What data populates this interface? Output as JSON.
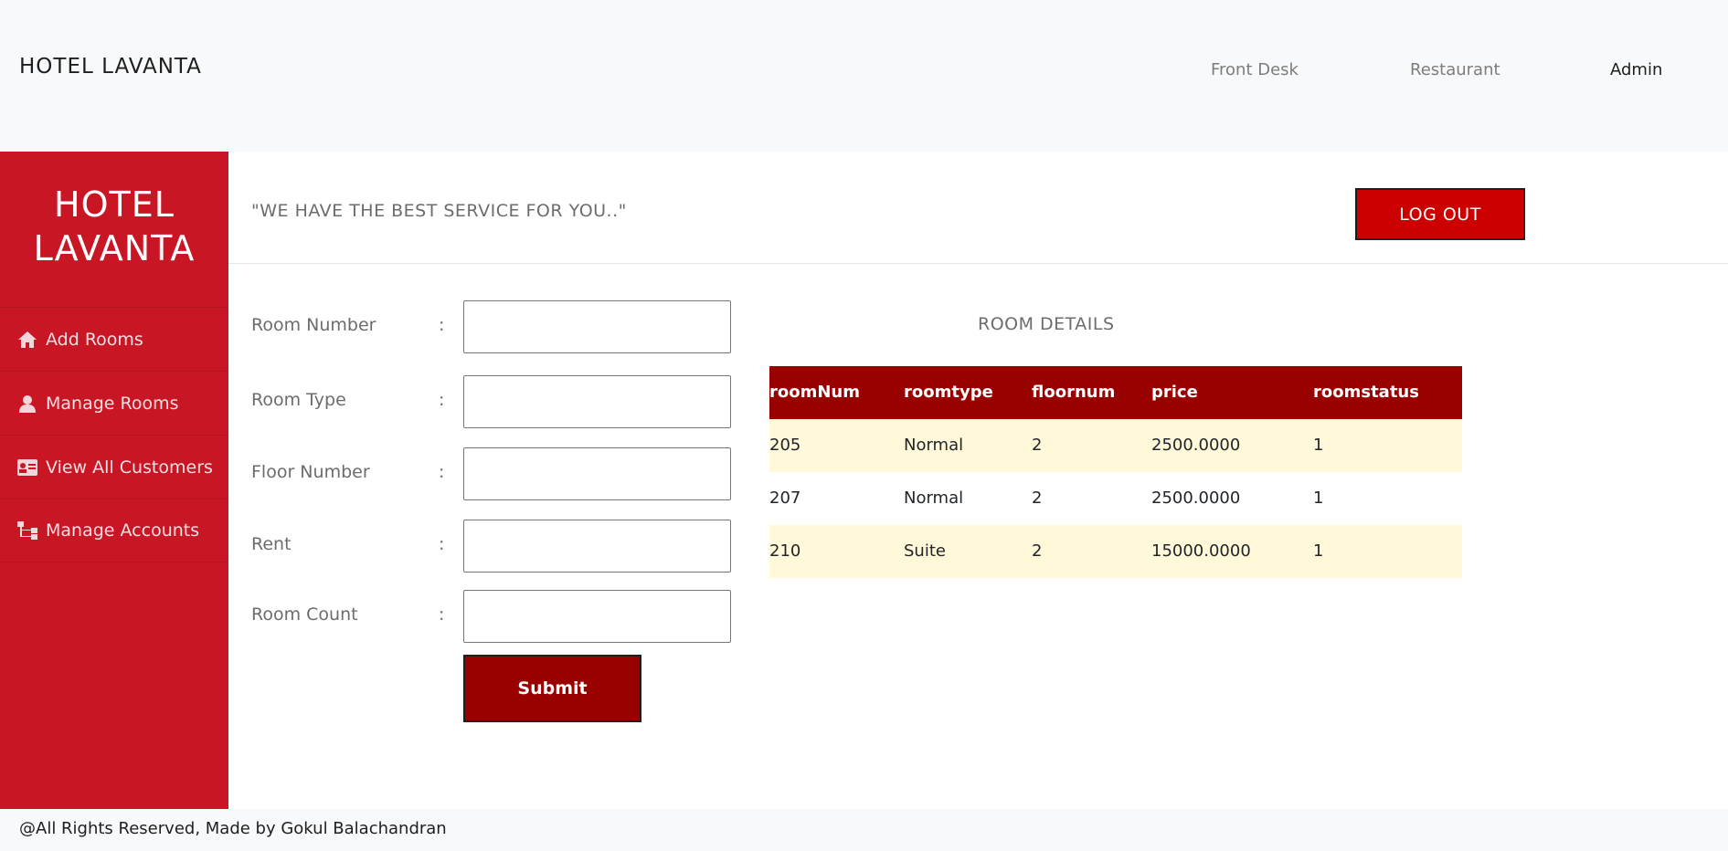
{
  "header": {
    "brand": "HOTEL LAVANTA",
    "nav": [
      {
        "label": "Front Desk"
      },
      {
        "label": "Restaurant"
      },
      {
        "label": "Admin"
      }
    ]
  },
  "sidebar": {
    "title_line1": "HOTEL",
    "title_line2": "LAVANTA",
    "items": [
      {
        "label": "Add Rooms",
        "icon": "home-icon"
      },
      {
        "label": "Manage Rooms",
        "icon": "user-icon"
      },
      {
        "label": "View All Customers",
        "icon": "id-card-icon"
      },
      {
        "label": "Manage Accounts",
        "icon": "sitemap-icon"
      }
    ]
  },
  "main": {
    "tagline": "\"WE HAVE THE BEST SERVICE FOR YOU..\"",
    "logout_label": "LOG OUT",
    "form": {
      "fields": [
        {
          "label": "Room Number",
          "colon": ":",
          "value": ""
        },
        {
          "label": "Room Type",
          "colon": ":",
          "value": ""
        },
        {
          "label": "Floor Number",
          "colon": ":",
          "value": ""
        },
        {
          "label": "Rent",
          "colon": ":",
          "value": ""
        },
        {
          "label": "Room Count",
          "colon": ":",
          "value": ""
        }
      ],
      "submit_label": "Submit"
    },
    "room_details": {
      "title": "ROOM DETAILS",
      "columns": [
        "roomNum",
        "roomtype",
        "floornum",
        "price",
        "roomstatus"
      ],
      "rows": [
        [
          "205",
          "Normal",
          "2",
          "2500.0000",
          "1"
        ],
        [
          "207",
          "Normal",
          "2",
          "2500.0000",
          "1"
        ],
        [
          "210",
          "Suite",
          "2",
          "15000.0000",
          "1"
        ]
      ]
    }
  },
  "footer": {
    "text": "@All Rights Reserved, Made by Gokul Balachandran"
  },
  "colors": {
    "sidebar_bg": "#c81624",
    "table_header_bg": "#990000",
    "table_alt_row": "#fff8d9",
    "logout_bg": "#cc0000",
    "submit_bg": "#990000"
  }
}
